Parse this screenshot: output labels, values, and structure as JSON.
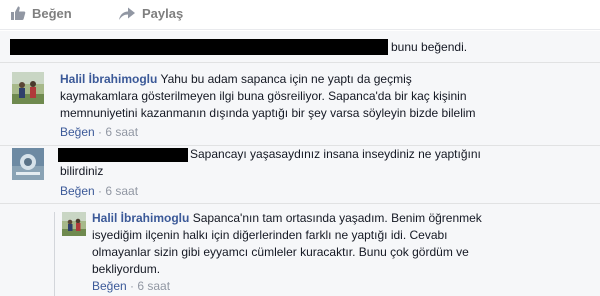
{
  "actions": {
    "like_label": "Beğen",
    "share_label": "Paylaş"
  },
  "likes_summary": {
    "suffix": "bunu beğendi."
  },
  "comments": [
    {
      "author": "Halil İbrahimoglu",
      "text_line1": "Yahu bu adam sapanca için ne yaptı da geçmiş",
      "text_line2": "kaymakamlara gösterilmeyen ilgi buna gösreiliyor. Sapanca'da bir kaç kişinin",
      "text_line3": "memnuniyetini kazanmanın dışında yaptığı bir şey varsa söyleyin bizde bilelim",
      "like_label": "Beğen",
      "separator": " · ",
      "time": "6 saat"
    },
    {
      "text_line1": "Sapancayı yaşasaydınız insana inseydiniz ne yaptığını",
      "text_line2": "bilirdiniz",
      "like_label": "Beğen",
      "separator": " · ",
      "time": "6 saat"
    }
  ],
  "reply": {
    "author": "Halil İbrahimoglu",
    "text_line1": "Sapanca'nın tam ortasında yaşadım. Benim öğrenmek",
    "text_line2": "isyediğim ilçenin halkı için diğerlerinden farklı ne yaptığı idi. Cevabı",
    "text_line3": "olmayanlar sizin gibi eyyamcı cümleler kuracaktır. Bunu çok gördüm ve",
    "text_line4": "bekliyordum.",
    "like_label": "Beğen",
    "separator": " · ",
    "time": "6 saat"
  },
  "colors": {
    "link": "#3b5998",
    "meta": "#9197a3",
    "panel_bg": "#f6f7f9"
  },
  "icons": [
    "thumbs-up-icon",
    "share-arrow-icon"
  ]
}
